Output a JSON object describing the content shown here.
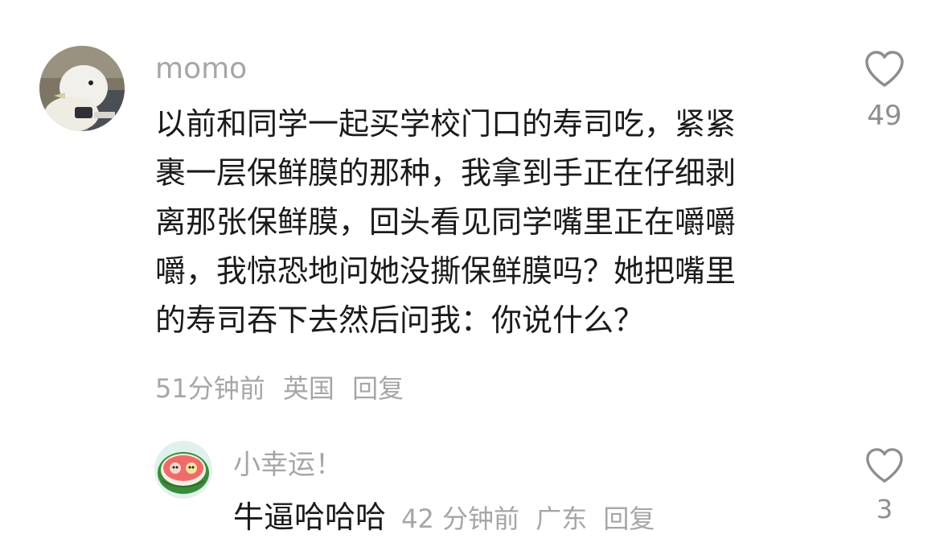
{
  "comment": {
    "username": "momo",
    "avatar_icon": "duck-plush-avatar",
    "body_lines": [
      "以前和同学一起买学校门口的寿司吃，紧紧",
      "裹一层保鲜膜的那种，我拿到手正在仔细剥",
      "离那张保鲜膜，回头看见同学嘴里正在嚼嚼",
      "嚼，我惊恐地问她没撕保鲜膜吗？她把嘴里",
      "的寿司吞下去然后问我：你说什么？"
    ],
    "time": "51分钟前",
    "location": "英国",
    "reply_label": "回复",
    "like_icon": "heart-outline-icon",
    "like_count": "49"
  },
  "reply": {
    "username": "小幸运！",
    "avatar_icon": "watermelon-avatar",
    "text": "牛逼哈哈哈",
    "time": "42 分钟前",
    "location": "广东",
    "reply_label": "回复",
    "like_icon": "heart-outline-icon",
    "like_count": "3"
  },
  "colors": {
    "text_primary": "#1a1a1a",
    "text_secondary": "#a6a6a6",
    "icon_gray": "#8e8e8e"
  }
}
